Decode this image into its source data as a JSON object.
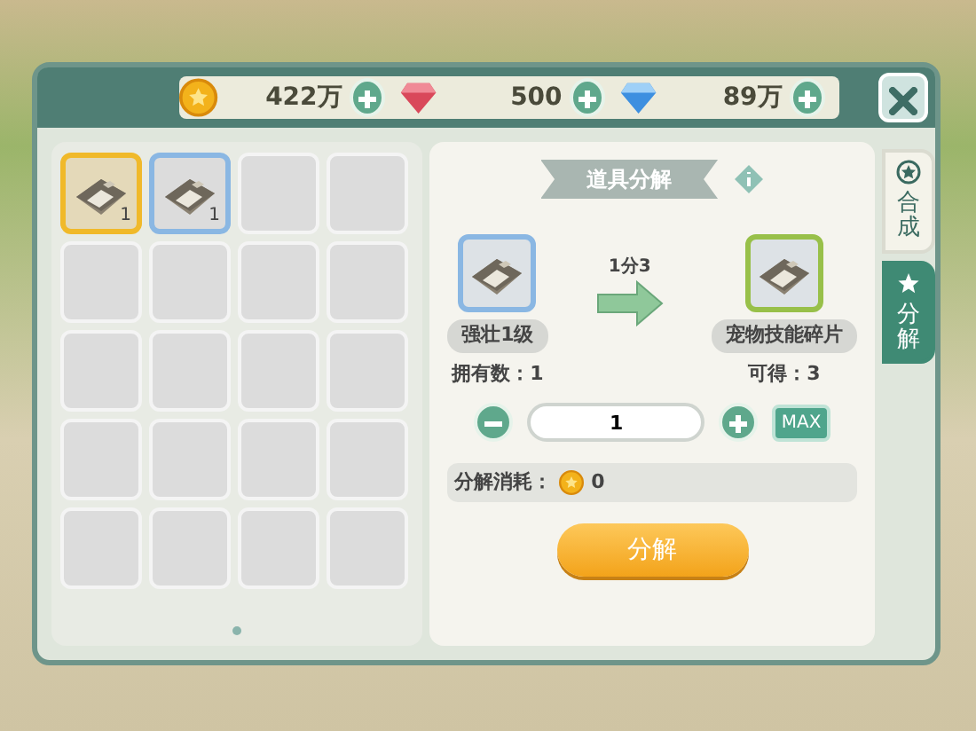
{
  "currencies": [
    {
      "kind": "coin",
      "amount": "422万"
    },
    {
      "kind": "ruby",
      "amount": "500"
    },
    {
      "kind": "diamond",
      "amount": "89万"
    }
  ],
  "inventory": {
    "slots": [
      {
        "kind": "item",
        "count": "1",
        "selected": true
      },
      {
        "kind": "item",
        "count": "1",
        "selected": false
      },
      {
        "kind": "empty",
        "selected": false
      },
      {
        "kind": "empty",
        "selected": false
      },
      {
        "kind": "empty",
        "selected": false
      },
      {
        "kind": "empty",
        "selected": false
      },
      {
        "kind": "empty",
        "selected": false
      },
      {
        "kind": "empty",
        "selected": false
      },
      {
        "kind": "empty",
        "selected": false
      },
      {
        "kind": "empty",
        "selected": false
      },
      {
        "kind": "empty",
        "selected": false
      },
      {
        "kind": "empty",
        "selected": false
      },
      {
        "kind": "empty",
        "selected": false
      },
      {
        "kind": "empty",
        "selected": false
      },
      {
        "kind": "empty",
        "selected": false
      },
      {
        "kind": "empty",
        "selected": false
      },
      {
        "kind": "empty",
        "selected": false
      },
      {
        "kind": "empty",
        "selected": false
      },
      {
        "kind": "empty",
        "selected": false
      },
      {
        "kind": "empty",
        "selected": false
      }
    ],
    "pages": [
      {
        "selected": true
      }
    ]
  },
  "decompose": {
    "title": "道具分解",
    "source": {
      "name": "强壮1级",
      "note": "拥有数：1"
    },
    "ratio": "1分3",
    "result": {
      "name": "宠物技能碎片",
      "note": "可得：3"
    },
    "quantity": "1",
    "max_label": "MAX",
    "cost_label": "分解消耗：",
    "cost": "0",
    "button": "分解"
  },
  "tabs": [
    {
      "label": "合成",
      "selected": false
    },
    {
      "label": "分解",
      "selected": true
    }
  ]
}
